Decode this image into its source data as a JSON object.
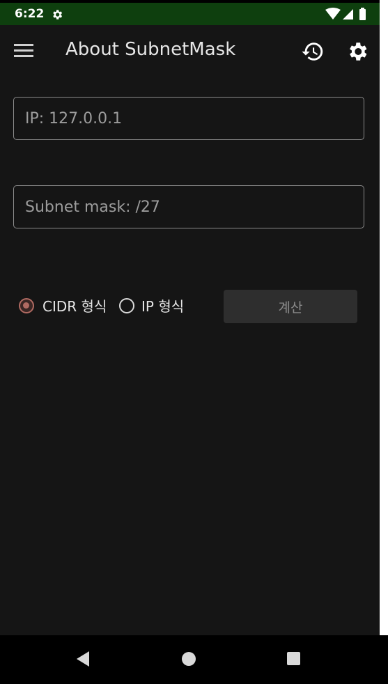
{
  "status_bar": {
    "time": "6:22",
    "icons": [
      "gear-icon",
      "wifi-icon",
      "signal-icon",
      "battery-icon"
    ],
    "bg_color": "#0e3f0e"
  },
  "app_bar": {
    "title": "About SubnetMask",
    "icons": [
      "menu-icon",
      "history-icon",
      "settings-icon"
    ]
  },
  "form": {
    "ip_field": {
      "value": "",
      "placeholder": "IP: 127.0.0.1"
    },
    "mask_field": {
      "value": "",
      "placeholder": "Subnet mask: /27"
    },
    "format_options": [
      {
        "label": "CIDR 형식",
        "selected": true
      },
      {
        "label": "IP 형식",
        "selected": false
      }
    ],
    "calculate_label": "계산"
  },
  "colors": {
    "background": "#151515",
    "accent": "#b06a62",
    "button_bg": "#2e2e2e"
  },
  "nav_bar": {
    "icons": [
      "back-icon",
      "home-icon",
      "recents-icon"
    ]
  }
}
